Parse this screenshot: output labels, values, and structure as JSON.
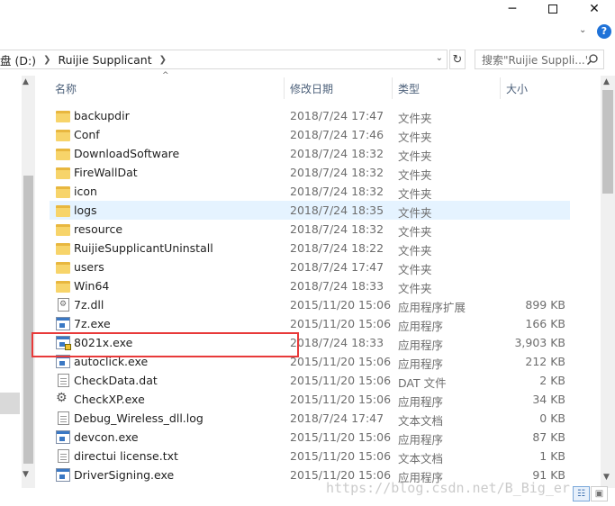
{
  "window": {
    "minimize_glyph": "─",
    "close_glyph": "✕"
  },
  "address": {
    "crumbs": [
      "盘 (D:)",
      "Ruijie Supplicant"
    ],
    "search_placeholder": "搜索\"Ruijie Suppli...\""
  },
  "columns": {
    "name": "名称",
    "date": "修改日期",
    "type": "类型",
    "size": "大小"
  },
  "files": [
    {
      "name": "backupdir",
      "date": "2018/7/24 17:47",
      "type": "文件夹",
      "size": "",
      "icon": "folder-icon"
    },
    {
      "name": "Conf",
      "date": "2018/7/24 17:46",
      "type": "文件夹",
      "size": "",
      "icon": "folder-icon"
    },
    {
      "name": "DownloadSoftware",
      "date": "2018/7/24 18:32",
      "type": "文件夹",
      "size": "",
      "icon": "folder-icon"
    },
    {
      "name": "FireWallDat",
      "date": "2018/7/24 18:32",
      "type": "文件夹",
      "size": "",
      "icon": "folder-icon"
    },
    {
      "name": "icon",
      "date": "2018/7/24 18:32",
      "type": "文件夹",
      "size": "",
      "icon": "folder-icon"
    },
    {
      "name": "logs",
      "date": "2018/7/24 18:35",
      "type": "文件夹",
      "size": "",
      "icon": "folder-icon"
    },
    {
      "name": "resource",
      "date": "2018/7/24 18:32",
      "type": "文件夹",
      "size": "",
      "icon": "folder-icon"
    },
    {
      "name": "RuijieSupplicantUninstall",
      "date": "2018/7/24 18:22",
      "type": "文件夹",
      "size": "",
      "icon": "folder-icon"
    },
    {
      "name": "users",
      "date": "2018/7/24 17:47",
      "type": "文件夹",
      "size": "",
      "icon": "folder-icon"
    },
    {
      "name": "Win64",
      "date": "2018/7/24 18:33",
      "type": "文件夹",
      "size": "",
      "icon": "folder-icon"
    },
    {
      "name": "7z.dll",
      "date": "2015/11/20 15:06",
      "type": "应用程序扩展",
      "size": "899 KB",
      "icon": "dll-icon"
    },
    {
      "name": "7z.exe",
      "date": "2015/11/20 15:06",
      "type": "应用程序",
      "size": "166 KB",
      "icon": "exe-icon"
    },
    {
      "name": "8021x.exe",
      "date": "2018/7/24 18:33",
      "type": "应用程序",
      "size": "3,903 KB",
      "icon": "exe-shield-icon"
    },
    {
      "name": "autoclick.exe",
      "date": "2015/11/20 15:06",
      "type": "应用程序",
      "size": "212 KB",
      "icon": "exe-icon"
    },
    {
      "name": "CheckData.dat",
      "date": "2015/11/20 15:06",
      "type": "DAT 文件",
      "size": "2 KB",
      "icon": "file-icon"
    },
    {
      "name": "CheckXP.exe",
      "date": "2015/11/20 15:06",
      "type": "应用程序",
      "size": "34 KB",
      "icon": "gear-exe-icon"
    },
    {
      "name": "Debug_Wireless_dll.log",
      "date": "2018/7/24 17:47",
      "type": "文本文档",
      "size": "0 KB",
      "icon": "text-file-icon"
    },
    {
      "name": "devcon.exe",
      "date": "2015/11/20 15:06",
      "type": "应用程序",
      "size": "87 KB",
      "icon": "exe-icon"
    },
    {
      "name": "directui license.txt",
      "date": "2015/11/20 15:06",
      "type": "文本文档",
      "size": "1 KB",
      "icon": "text-file-icon"
    },
    {
      "name": "DriverSigning.exe",
      "date": "2015/11/20 15:06",
      "type": "应用程序",
      "size": "91 KB",
      "icon": "exe-icon"
    }
  ],
  "watermark": "https://blog.csdn.net/B_Big_er"
}
